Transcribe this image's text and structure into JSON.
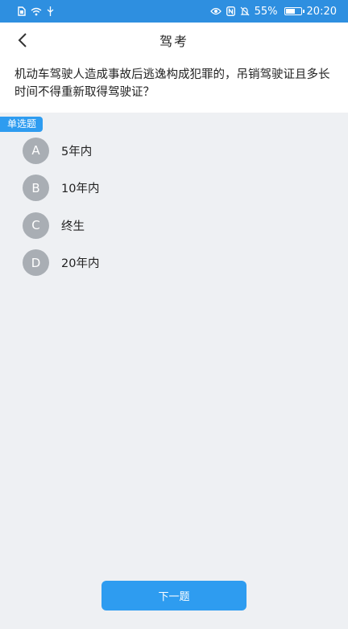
{
  "status_bar": {
    "battery_text": "55%",
    "battery_level": 0.55,
    "time": "20:20",
    "icons": [
      "sim-icon",
      "wifi-icon",
      "usb-icon",
      "eye-icon",
      "nfc-icon",
      "mute-icon",
      "battery-icon"
    ]
  },
  "header": {
    "title": "驾考",
    "back_icon": "chevron-left-icon"
  },
  "question": {
    "text": "机动车驾驶人造成事故后逃逸构成犯罪的，吊销驾驶证且多长时间不得重新取得驾驶证？",
    "type_label": "单选题"
  },
  "options": [
    {
      "letter": "A",
      "text": "5年内"
    },
    {
      "letter": "B",
      "text": "10年内"
    },
    {
      "letter": "C",
      "text": "终生"
    },
    {
      "letter": "D",
      "text": "20年内"
    }
  ],
  "footer": {
    "next_label": "下一题"
  },
  "colors": {
    "accent": "#2e9cf0",
    "status_bar": "#2e8fe0",
    "option_circle": "#a9aeb4",
    "background": "#eef0f3"
  }
}
